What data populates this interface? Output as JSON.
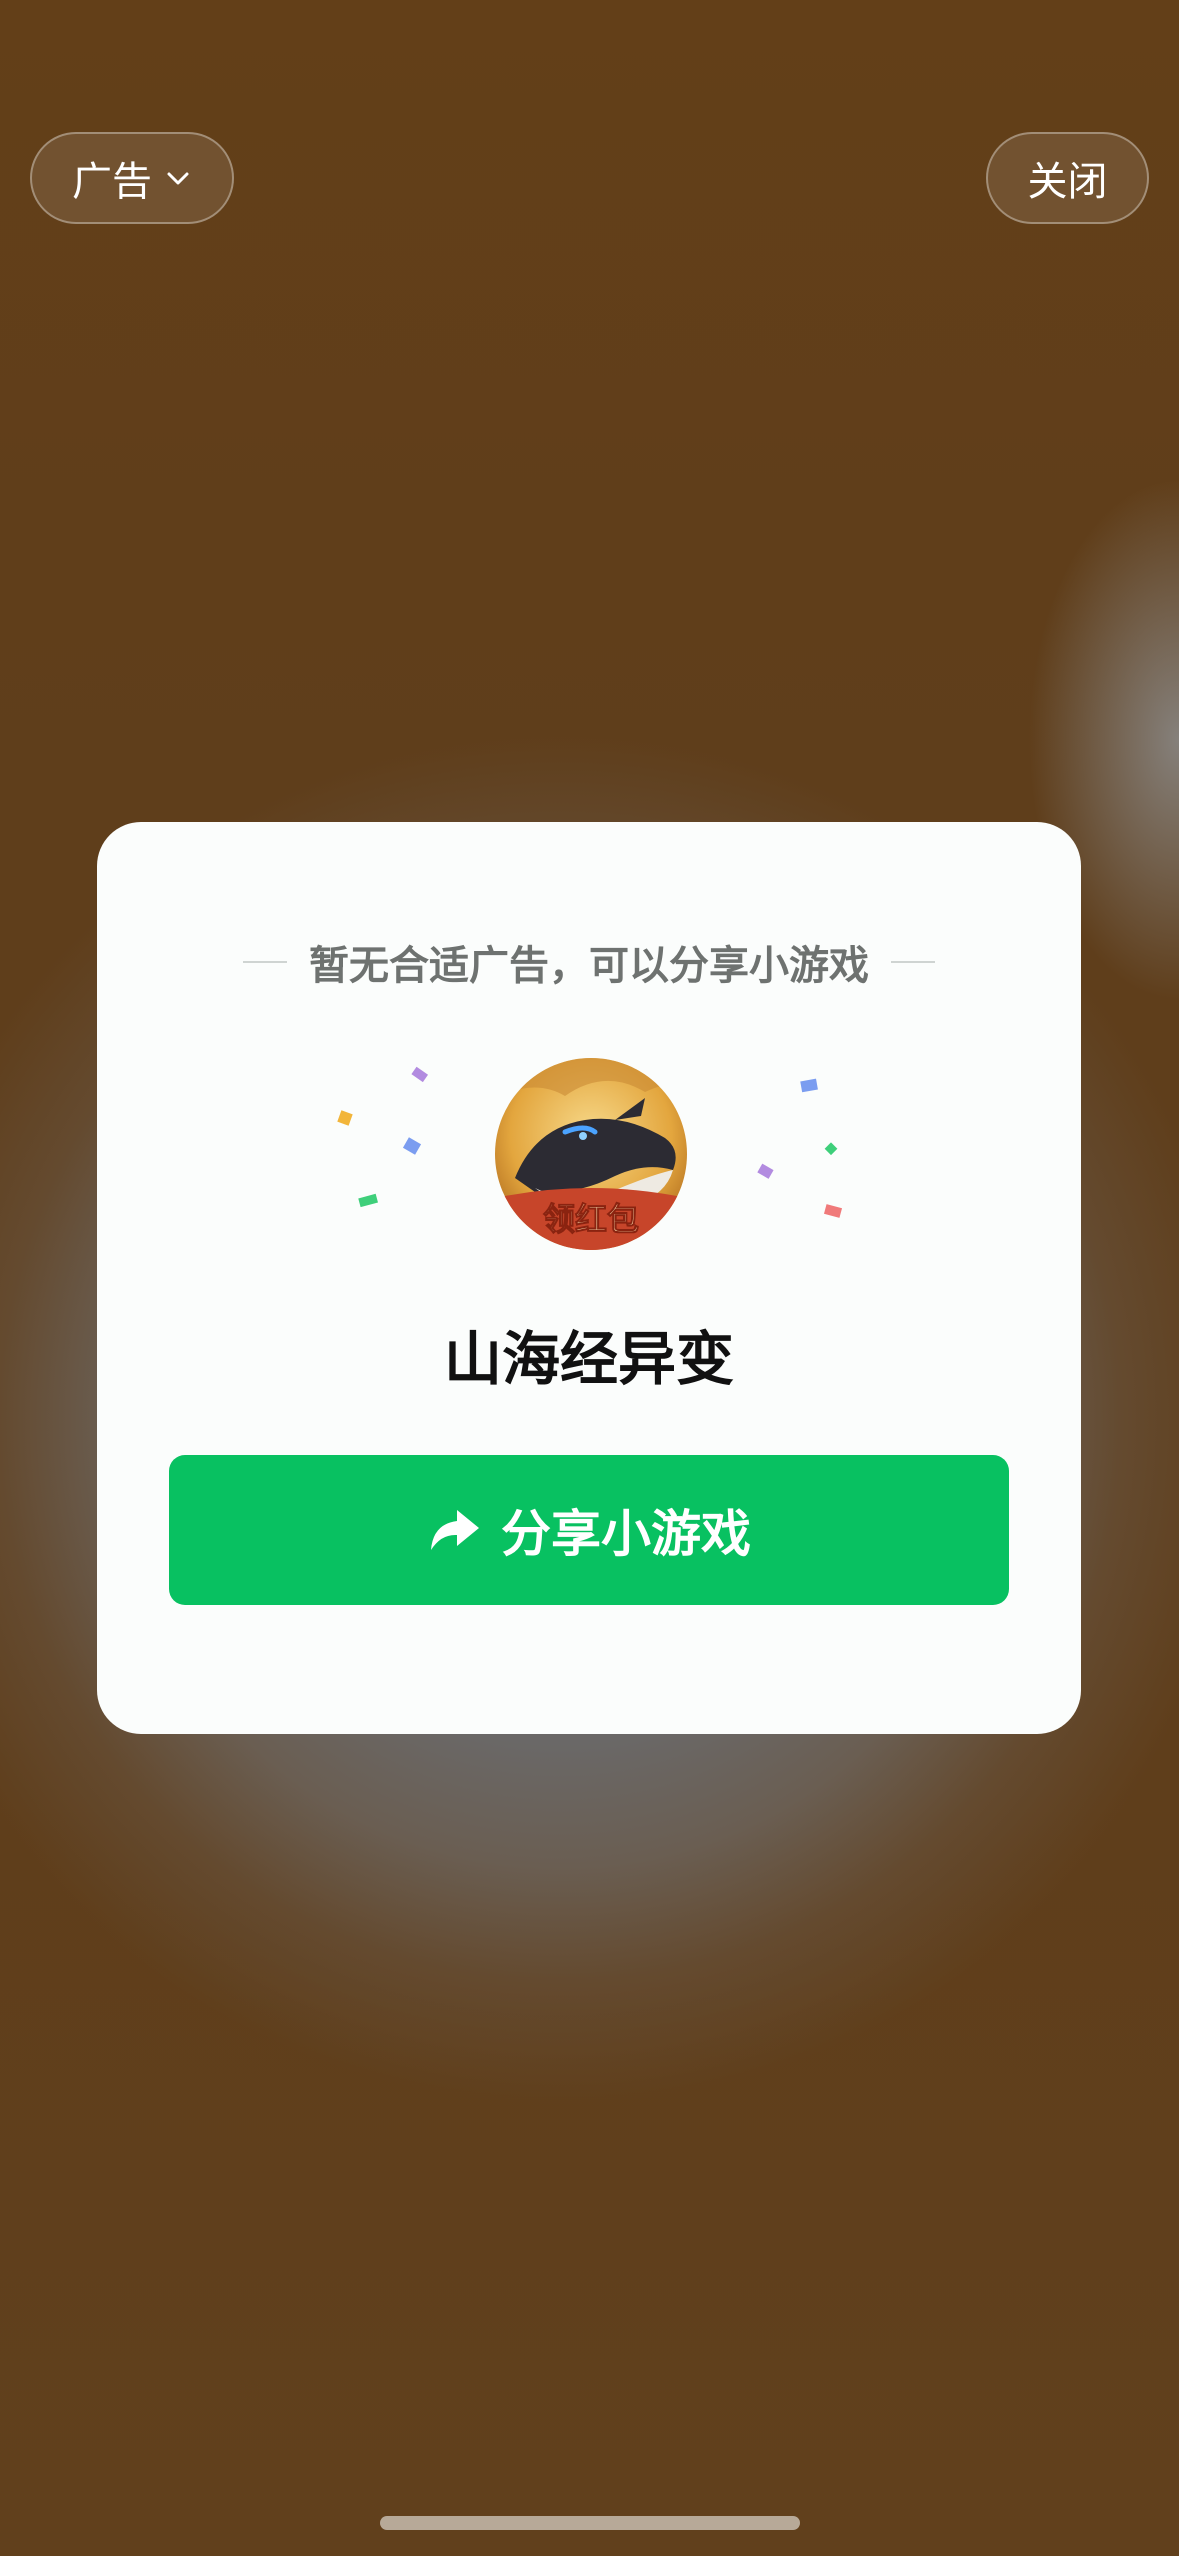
{
  "top_bar": {
    "ad_label": "广告",
    "close_label": "关闭"
  },
  "card": {
    "subtitle": "暂无合适广告，可以分享小游戏",
    "game_logo_text": "领红包",
    "game_name": "山海经异变",
    "share_button_label": "分享小游戏"
  },
  "icons": {
    "ad_dropdown": "chevron-down-icon",
    "share": "share-arrow-icon"
  },
  "colors": {
    "background": "#5f3e1b",
    "card": "#fbfdfc",
    "share_button": "#08c161"
  }
}
